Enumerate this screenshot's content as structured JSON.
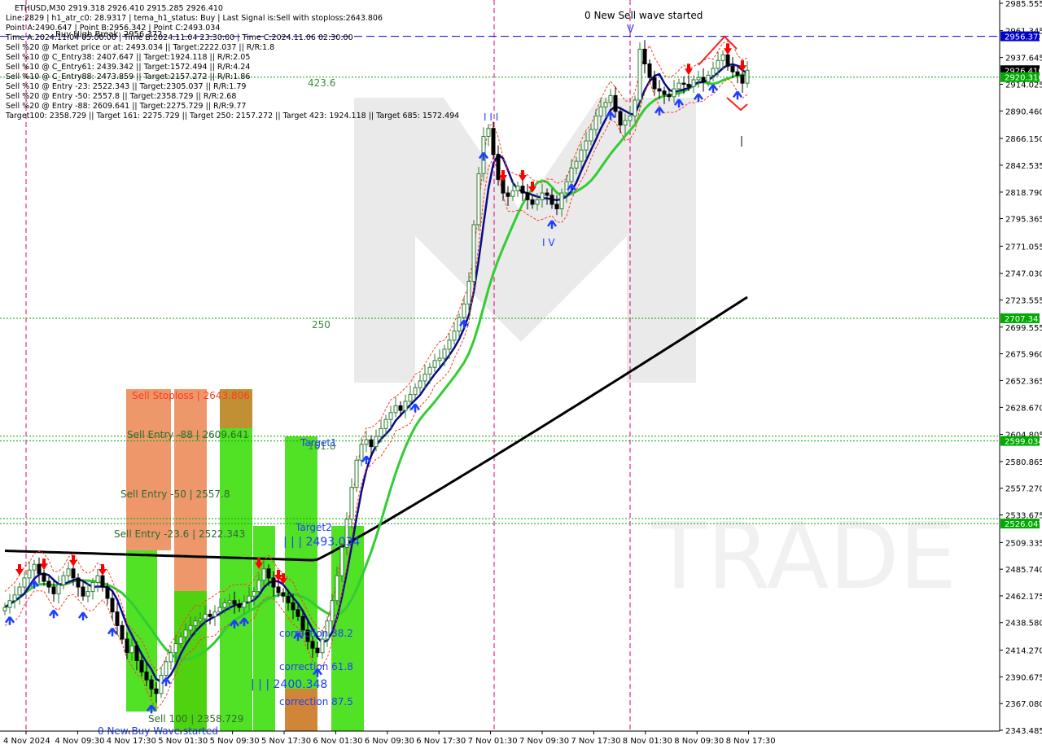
{
  "info_panel": {
    "lines": [
      "ETHUSD,M30  2919.318 2926.410 2915.285 2926.410",
      "Line:2829 | h1_atr_c0: 28.9317 | tema_h1_status: Buy | Last Signal is:Sell with stoploss:2643.806",
      "Point A:2490.647 | Point B:2956.342 | Point C:2493.034",
      "Time A:2024.11.04 05:00:00 | Time B:2024.11.04 23:30:00 | Time C:2024.11.06 02:30:00",
      "Sell %20 @ Market price or at: 2493.034 || Target:2222.037 || R/R:1.8",
      "Sell %10 @ C_Entry38: 2407.647 || Target:1924.118 || R/R:2.05",
      "Sell %10 @ C_Entry61: 2439.342 || Target:1572.494 || R/R:4.24",
      "Sell %10 @ C_Entry88: 2473.859 || Target:2157.272 || R/R:1.86",
      "Sell %10 @ Entry -23: 2522.343 || Target:2305.037 || R/R:1.79",
      "Sell %20 @ Entry -50: 2557.8 || Target:2358.729 || R/R:2.68",
      "Sell %20 @ Entry -88: 2609.641 || Target:2275.729 || R/R:9.77",
      "Target100: 2358.729 || Target 161: 2275.729 || Target 250: 2157.272 || Target 423: 1924.118 || Target 685: 1572.494"
    ],
    "overlay": "Buy High Break: 2956.372"
  },
  "watermark": "TRADE",
  "annotations": {
    "new_sell_wave": "0 New Sell wave started",
    "new_buy_wave": "0 New Buy Wave started",
    "fib_4236": "423.6",
    "fib_250": "250",
    "fib_1618": "161.8",
    "target1": "Target1",
    "target2": "Target2",
    "point_c": "| | | 2493.034",
    "point_low": "| | | 2400.348",
    "corr_382": "correction 38.2",
    "corr_618": "correction 61.8",
    "corr_875": "correction 87.5",
    "sell_stoploss": "Sell Stoploss | 2643.806",
    "sell_entry_88": "Sell Entry -88 | 2609.641",
    "sell_entry_50": "Sell Entry -50 | 2557.8",
    "sell_entry_23": "Sell Entry -23.6 | 2522.343",
    "sell_100": "Sell 100 | 2358.729",
    "wave_iii": "I I I",
    "wave_iv": "I V"
  },
  "colors": {
    "background": "#ffffff",
    "bull_candle": "#2e7d32",
    "bear_candle": "#000000",
    "blue_ma": "#0a0a8a",
    "green_ma": "#33cc33",
    "black_ma": "#000000",
    "sell_arrow": "#ff0000",
    "buy_arrow": "#1f3fff",
    "magenta_line": "#e0007a",
    "level_line": "#00aa00",
    "high_line": "#0000cc",
    "zone_green": "#33dd00",
    "zone_orange": "#e8743a"
  },
  "chart_data": {
    "type": "candlestick",
    "symbol": "ETHUSD,M30",
    "y_axis": {
      "min": 2343.485,
      "max": 2985.555,
      "ticks": [
        2985.555,
        2961.345,
        2937.645,
        2914.025,
        2890.46,
        2866.15,
        2842.535,
        2818.79,
        2795.365,
        2771.055,
        2747.03,
        2723.555,
        2699.555,
        2675.96,
        2652.365,
        2628.67,
        2604.805,
        2580.865,
        2557.27,
        2533.675,
        2509.335,
        2485.74,
        2462.175,
        2438.58,
        2414.27,
        2390.675,
        2367.08,
        2343.485
      ]
    },
    "x_axis": {
      "labels": [
        "4 Nov 2024",
        "4 Nov 09:30",
        "4 Nov 17:30",
        "5 Nov 01:30",
        "5 Nov 09:30",
        "5 Nov 17:30",
        "6 Nov 01:30",
        "6 Nov 09:30",
        "6 Nov 17:30",
        "7 Nov 01:30",
        "7 Nov 09:30",
        "7 Nov 17:30",
        "8 Nov 01:30",
        "8 Nov 09:30",
        "8 Nov 17:30"
      ]
    },
    "price_tags": [
      {
        "value": 2956.372,
        "label": "2956.372",
        "color": "#0000cc"
      },
      {
        "value": 2926.41,
        "label": "2926.410",
        "color": "#000000"
      },
      {
        "value": 2920.316,
        "label": "2920.316",
        "color": "#00aa00"
      },
      {
        "value": 2707.341,
        "label": "2707.341",
        "color": "#00aa00"
      },
      {
        "value": 2599.034,
        "label": "2599.034",
        "color": "#00aa00"
      },
      {
        "value": 2526.047,
        "label": "2526.047",
        "color": "#00aa00"
      }
    ],
    "levels": [
      {
        "value": 2956.372,
        "style": "dash-blue"
      },
      {
        "value": 2920.316,
        "style": "dot-green"
      },
      {
        "value": 2707.341,
        "style": "dot-green"
      },
      {
        "value": 2599.034,
        "style": "dot-green"
      },
      {
        "value": 2603.2,
        "style": "dot-green"
      },
      {
        "value": 2526.047,
        "style": "dot-green"
      },
      {
        "value": 2530.4,
        "style": "dot-green"
      }
    ],
    "close": [
      2452,
      2458,
      2463,
      2470,
      2478,
      2485,
      2490,
      2482,
      2475,
      2470,
      2464,
      2472,
      2480,
      2486,
      2478,
      2470,
      2462,
      2466,
      2474,
      2480,
      2470,
      2460,
      2448,
      2436,
      2424,
      2412,
      2418,
      2405,
      2395,
      2388,
      2380,
      2376,
      2392,
      2404,
      2412,
      2420,
      2426,
      2432,
      2436,
      2440,
      2442,
      2446,
      2444,
      2448,
      2452,
      2456,
      2458,
      2455,
      2452,
      2457,
      2462,
      2466,
      2476,
      2486,
      2478,
      2470,
      2465,
      2462,
      2456,
      2450,
      2444,
      2432,
      2422,
      2416,
      2412,
      2424,
      2440,
      2458,
      2480,
      2505,
      2530,
      2558,
      2582,
      2596,
      2600,
      2594,
      2603,
      2610,
      2618,
      2624,
      2630,
      2626,
      2634,
      2640,
      2646,
      2652,
      2658,
      2664,
      2670,
      2672,
      2680,
      2688,
      2696,
      2708,
      2720,
      2740,
      2790,
      2835,
      2868,
      2875,
      2852,
      2830,
      2818,
      2815,
      2820,
      2824,
      2818,
      2812,
      2808,
      2812,
      2818,
      2816,
      2808,
      2804,
      2818,
      2828,
      2840,
      2846,
      2856,
      2864,
      2874,
      2886,
      2894,
      2898,
      2904,
      2890,
      2878,
      2882,
      2886,
      2900,
      2945,
      2932,
      2920,
      2910,
      2908,
      2905,
      2903,
      2910,
      2915,
      2914,
      2912,
      2918,
      2920,
      2916,
      2922,
      2928,
      2935,
      2940,
      2930,
      2925,
      2922,
      2915,
      2926.41
    ]
  }
}
